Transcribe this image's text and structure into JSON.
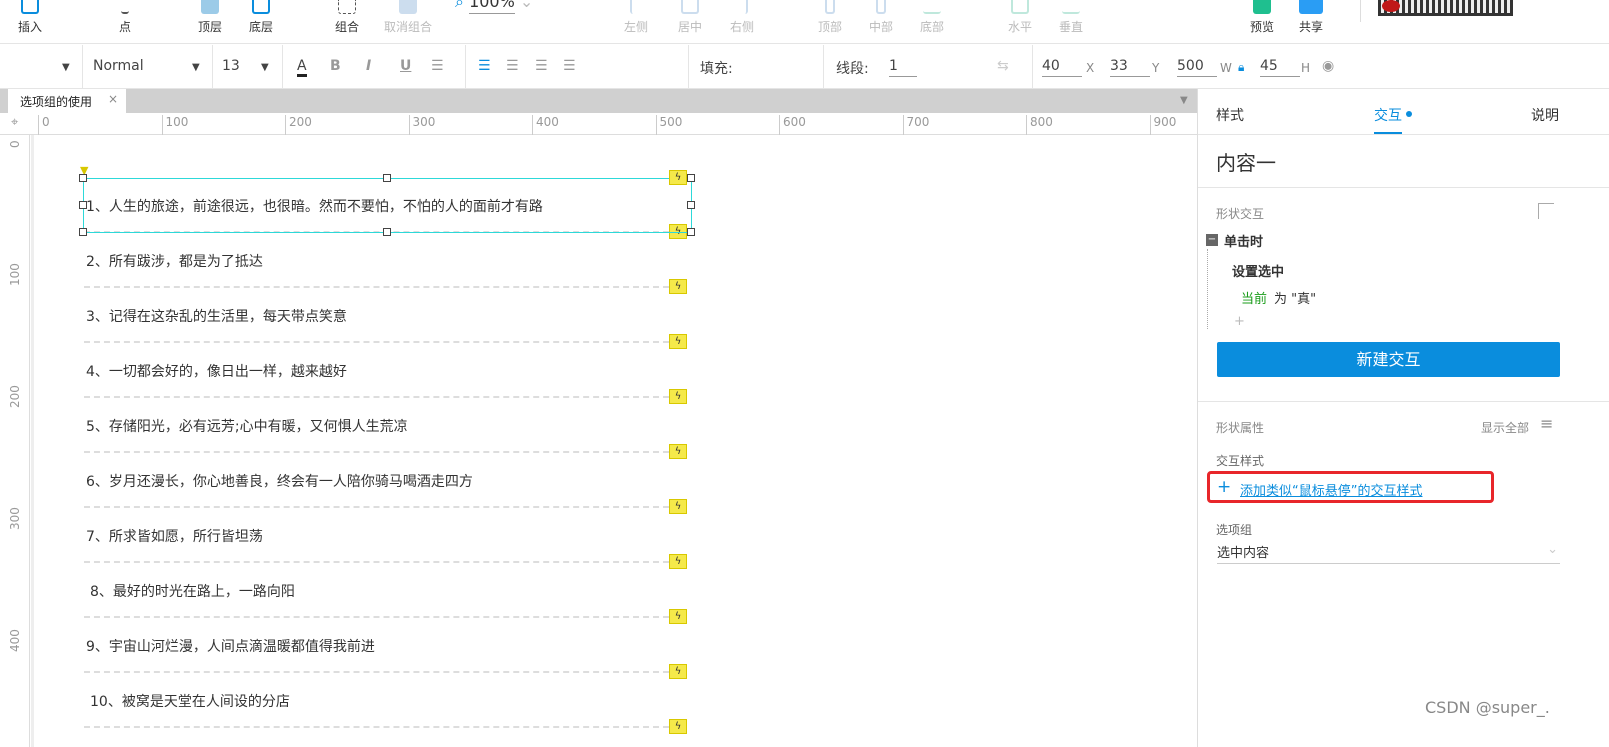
{
  "toolbar": {
    "insert": "插入",
    "point": "点",
    "bring_front": "顶层",
    "send_back": "底层",
    "group": "组合",
    "ungroup": "取消组合",
    "zoom": "100%",
    "align_left": "左侧",
    "align_center": "居中",
    "align_right": "右侧",
    "align_top": "顶部",
    "align_middle": "中部",
    "align_bottom": "底部",
    "dist_h": "水平",
    "dist_v": "垂直",
    "preview": "预览",
    "share": "共享"
  },
  "format": {
    "style": "Normal",
    "font_size": "13",
    "fill_label": "填充:",
    "line_label": "线段:",
    "line_width": "1",
    "x": "40",
    "x_label": "X",
    "y": "33",
    "y_label": "Y",
    "w": "500",
    "w_label": "W",
    "h": "45",
    "h_label": "H"
  },
  "tab": {
    "title": "选项组的使用",
    "close": "×"
  },
  "ruler": {
    "h": [
      "0",
      "100",
      "200",
      "300",
      "400",
      "500",
      "600",
      "700",
      "800",
      "900"
    ],
    "v": [
      "0",
      "100",
      "200",
      "300",
      "400"
    ]
  },
  "items": [
    "1、人生的旅途，前途很远，也很暗。然而不要怕，不怕的人的面前才有路",
    "2、所有跋涉，都是为了抵达",
    "3、记得在这杂乱的生活里，每天带点笑意",
    "4、一切都会好的，像日出一样，越来越好",
    "5、存储阳光，必有远芳;心中有暖，又何惧人生荒凉",
    "6、岁月还漫长，你心地善良，终会有一人陪你骑马喝酒走四方",
    "7、所求皆如愿，所行皆坦荡",
    "8、最好的时光在路上，一路向阳",
    "9、宇宙山河烂漫，人间点滴温暖都值得我前进",
    "10、被窝是天堂在人间设的分店"
  ],
  "panel": {
    "tabs": [
      "样式",
      "交互",
      "说明"
    ],
    "name": "内容一",
    "shape_interaction": "形状交互",
    "event": "单击时",
    "action": "设置选中",
    "target": "当前",
    "target_rest": "为 \"真\"",
    "add": "+",
    "new_interaction": "新建交互",
    "shape_props": "形状属性",
    "show_all": "显示全部",
    "interaction_style": "交互样式",
    "add_style_link": "添加类似“鼠标悬停”的交互样式",
    "option_group": "选项组",
    "option_group_value": "选中内容"
  },
  "watermark": "CSDN @super_.",
  "colors": {
    "accent": "#0a8ddd",
    "selection": "#2dd9d9",
    "highlight": "#e8262a",
    "green": "#1a9c1a"
  }
}
